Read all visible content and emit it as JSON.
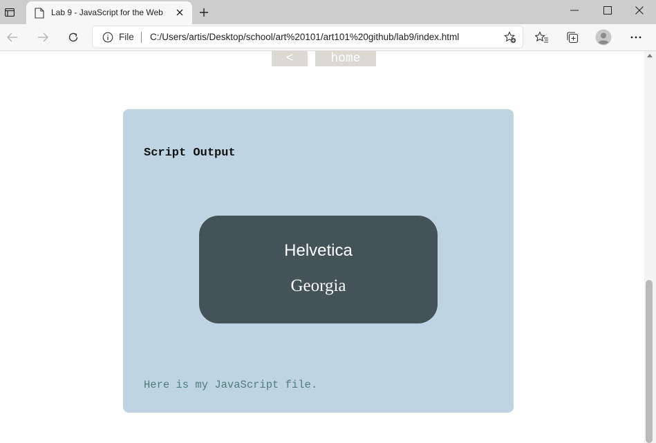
{
  "browser": {
    "tab": {
      "title": "Lab 9 - JavaScript for the Web"
    },
    "address": {
      "scheme_label": "File",
      "url": "C:/Users/artis/Desktop/school/art%20101/art101%20github/lab9/index.html"
    }
  },
  "page": {
    "nav": {
      "back_label": "<",
      "home_label": "home"
    },
    "card": {
      "title": "Script Output",
      "fonts": [
        "Helvetica",
        "Georgia"
      ],
      "footer": "Here is my JavaScript file."
    }
  },
  "icons": [
    "tab-actions-icon",
    "page-icon",
    "close-icon",
    "plus-icon",
    "minimize-icon",
    "maximize-icon",
    "close-window-icon",
    "back-arrow-icon",
    "forward-arrow-icon",
    "refresh-icon",
    "info-icon",
    "favorite-add-icon",
    "favorites-icon",
    "collections-icon",
    "profile-icon",
    "more-icon"
  ],
  "colors": {
    "card_bg": "#bfd4e2",
    "font_box_bg": "#435358",
    "footer_text": "#4e7e7a",
    "nav_button_bg": "#dcd8d2"
  }
}
